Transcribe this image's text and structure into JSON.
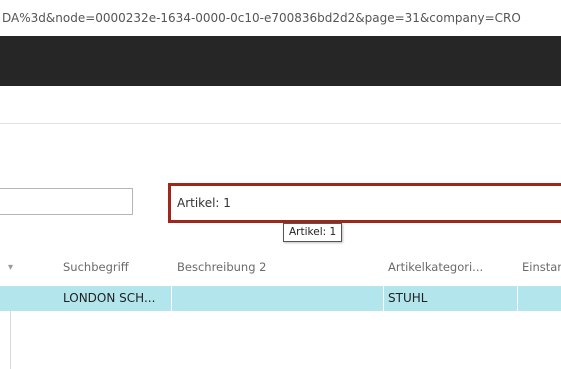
{
  "url": "DA%3d&node=0000232e-1634-0000-0c10-e700836bd2d2&page=31&company=CRO",
  "filter": {
    "value": "Artikel: 1",
    "tooltip": "Artikel: 1"
  },
  "table": {
    "columns": [
      "Suchbegriff",
      "Beschreibung 2",
      "Artikelkategori...",
      "Einstan"
    ],
    "rows": [
      {
        "suchbegriff": "LONDON SCH...",
        "beschreibung2": "",
        "artikelkategorie": "STUHL",
        "einstand": ""
      }
    ]
  },
  "colors": {
    "header_bg": "#262626",
    "filter_border": "#a0261c",
    "selected_row": "#b3e6ec"
  }
}
